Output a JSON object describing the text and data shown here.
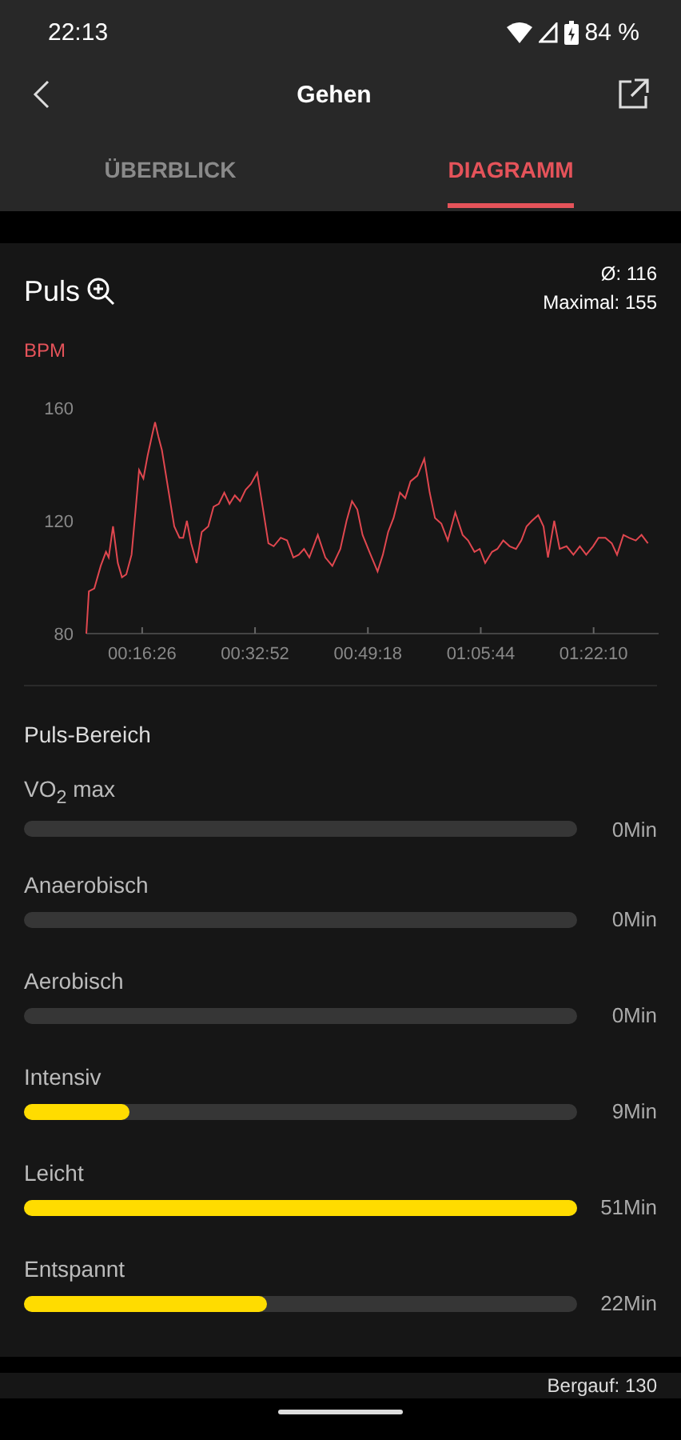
{
  "status_bar": {
    "time": "22:13",
    "battery": "84 %"
  },
  "app_bar": {
    "title": "Gehen"
  },
  "tabs": [
    {
      "label": "ÜBERBLICK",
      "selected": false
    },
    {
      "label": "DIAGRAMM",
      "selected": true
    }
  ],
  "pulse_card": {
    "title": "Puls",
    "average": "Ø: 116",
    "maximum": "Maximal: 155",
    "chart_data": {
      "type": "line",
      "ylabel": "BPM",
      "xlim": [
        498,
        5498
      ],
      "ylim": [
        80,
        160
      ],
      "yticks": [
        80,
        120,
        160
      ],
      "xticks": [
        {
          "value": 986,
          "label": "00:16:26"
        },
        {
          "value": 1972,
          "label": "00:32:52"
        },
        {
          "value": 2958,
          "label": "00:49:18"
        },
        {
          "value": 3944,
          "label": "01:05:44"
        },
        {
          "value": 4930,
          "label": "01:22:10"
        }
      ],
      "x": [
        498,
        521,
        568,
        624,
        670,
        693,
        731,
        773,
        810,
        847,
        893,
        931,
        959,
        996,
        1033,
        1070,
        1098,
        1126,
        1159,
        1219,
        1266,
        1312,
        1345,
        1377,
        1414,
        1461,
        1507,
        1563,
        1610,
        1656,
        1703,
        1749,
        1796,
        1842,
        1889,
        1935,
        1991,
        2038,
        2089,
        2135,
        2196,
        2252,
        2307,
        2354,
        2400,
        2447,
        2521,
        2586,
        2647,
        2717,
        2772,
        2819,
        2865,
        2912,
        2972,
        3042,
        3089,
        3135,
        3182,
        3238,
        3284,
        3331,
        3391,
        3451,
        3498,
        3544,
        3600,
        3656,
        3721,
        3786,
        3833,
        3889,
        3935,
        3982,
        4042,
        4089,
        4140,
        4196,
        4252,
        4298,
        4344,
        4391,
        4447,
        4493,
        4531,
        4586,
        4633,
        4693,
        4754,
        4810,
        4865,
        4926,
        4973,
        5033,
        5089,
        5135,
        5191,
        5238,
        5298,
        5349,
        5405
      ],
      "series": [
        {
          "color": "#e0474f",
          "values": [
            80,
            95,
            96,
            104,
            109,
            107,
            118,
            105,
            100,
            101,
            108,
            125,
            138,
            135,
            143,
            150,
            155,
            150,
            145,
            130,
            118,
            114,
            114,
            120,
            112,
            105,
            116,
            118,
            125,
            126,
            130,
            126,
            129,
            127,
            131,
            133,
            137,
            125,
            112,
            111,
            114,
            113,
            107,
            108,
            110,
            107,
            115,
            107,
            104,
            110,
            120,
            127,
            124,
            115,
            109,
            102,
            108,
            116,
            121,
            130,
            128,
            134,
            136,
            142,
            130,
            121,
            119,
            113,
            123,
            115,
            113,
            109,
            110,
            105,
            109,
            110,
            113,
            111,
            110,
            113,
            118,
            120,
            122,
            118,
            107,
            120,
            110,
            111,
            108,
            111,
            108,
            111,
            114,
            114,
            112,
            108,
            115,
            114,
            113,
            115,
            112
          ]
        }
      ]
    },
    "zones_title": "Puls-Bereich",
    "zones": [
      {
        "label": "VO$_{2}$ max",
        "reading": "0Min"
      },
      {
        "label": "Anaerobisch",
        "reading": "0Min"
      },
      {
        "label": "Aerobisch",
        "reading": "0Min"
      },
      {
        "label": "Intensiv",
        "level": 0.19,
        "reading": "9Min"
      },
      {
        "label": "Leicht",
        "level": 1,
        "reading": "51Min"
      },
      {
        "label": "Entspannt",
        "level": 0.44,
        "reading": "22Min"
      }
    ]
  },
  "next_card": {
    "ascent": "Bergauf: 130"
  }
}
